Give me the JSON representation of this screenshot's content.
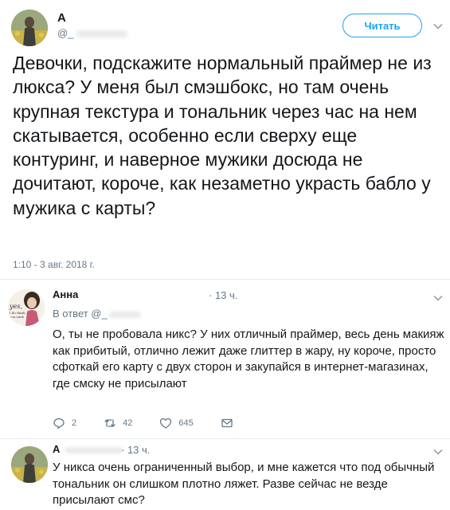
{
  "tweet": {
    "author_name": "А",
    "author_handle": "@_",
    "follow_label": "Читать",
    "text": "Девочки, подскажите нормальный праймер не из люкса? У меня был смэшбокс,  но там очень крупная текстура и тональник через час на нем скатывается,  особенно если сверху еще контуринг, и наверное мужики досюда не дочитают, короче, как незаметно украсть бабло у мужика с карты?",
    "time": "1:10 - 3 авг. 2018 г."
  },
  "reply1": {
    "author_name": "Анна",
    "time": "· 13 ч.",
    "in_reply": "В ответ @_",
    "text": "О, ты не пробовала никс? У них отличный праймер, весь день макияж как прибитый, отлично лежит даже глиттер в жару, ну короче, просто сфоткай его карту с двух сторон и закупайся в интернет-магазинах, где смску не присылают",
    "replies": "2",
    "retweets": "42",
    "likes": "645",
    "avatar_text": "yes, I do think you suck"
  },
  "reply2": {
    "author_name": "А",
    "time": "· 13 ч.",
    "text": "У никса очень ограниченный выбор, и мне кажется что под обычный тональник он слишком плотно ляжет. Разве сейчас не везде присылают смс?"
  },
  "icons": {
    "reply": "reply-icon",
    "retweet": "retweet-icon",
    "like": "heart-icon",
    "message": "envelope-icon",
    "menu": "chevron-down-icon"
  },
  "colors": {
    "accent": "#1da1f2",
    "secondary_text": "#657786",
    "divider": "#e6ecf0"
  }
}
